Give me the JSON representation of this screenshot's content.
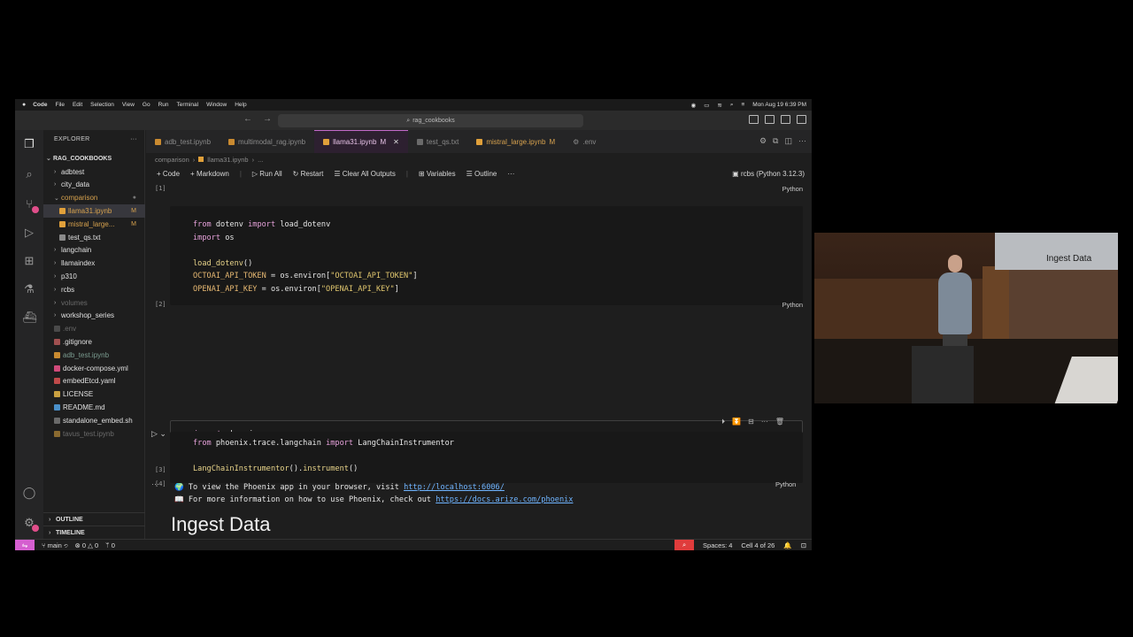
{
  "menubar": {
    "app": "Code",
    "items": [
      "File",
      "Edit",
      "Selection",
      "View",
      "Go",
      "Run",
      "Terminal",
      "Window",
      "Help"
    ],
    "datetime": "Mon Aug 19 6:39 PM"
  },
  "titlebar": {
    "search": "rag_cookbooks"
  },
  "sidebar": {
    "title": "EXPLORER",
    "root": "RAG_COOKBOOKS",
    "items": [
      {
        "label": "adbtest",
        "type": "folder"
      },
      {
        "label": "city_data",
        "type": "folder"
      },
      {
        "label": "comparison",
        "type": "folder-open"
      },
      {
        "label": "llama31.ipynb",
        "type": "file",
        "mod": "M"
      },
      {
        "label": "mistral_large...",
        "type": "file",
        "mod": "M"
      },
      {
        "label": "test_qs.txt",
        "type": "file"
      },
      {
        "label": "langchain",
        "type": "folder"
      },
      {
        "label": "llamaindex",
        "type": "folder"
      },
      {
        "label": "p310",
        "type": "folder"
      },
      {
        "label": "rcbs",
        "type": "folder"
      },
      {
        "label": "volumes",
        "type": "folder"
      },
      {
        "label": "workshop_series",
        "type": "folder"
      },
      {
        "label": ".env",
        "type": "file"
      },
      {
        "label": ".gitignore",
        "type": "file"
      },
      {
        "label": "adb_test.ipynb",
        "type": "file"
      },
      {
        "label": "docker-compose.yml",
        "type": "file"
      },
      {
        "label": "embedEtcd.yaml",
        "type": "file"
      },
      {
        "label": "LICENSE",
        "type": "file"
      },
      {
        "label": "README.md",
        "type": "file"
      },
      {
        "label": "standalone_embed.sh",
        "type": "file"
      },
      {
        "label": "tavus_test.ipynb",
        "type": "file"
      }
    ],
    "outline": "OUTLINE",
    "timeline": "TIMELINE"
  },
  "tabs": [
    {
      "label": "adb_test.ipynb"
    },
    {
      "label": "multimodal_rag.ipynb"
    },
    {
      "label": "llama31.ipynb",
      "mod": "M"
    },
    {
      "label": "test_qs.txt"
    },
    {
      "label": "mistral_large.ipynb",
      "mod": "M"
    },
    {
      "label": ".env"
    }
  ],
  "breadcrumb": [
    "comparison",
    "llama31.ipynb",
    "..."
  ],
  "toolbar": {
    "code": "Code",
    "markdown": "Markdown",
    "run_all": "Run All",
    "restart": "Restart",
    "clear": "Clear All Outputs",
    "variables": "Variables",
    "outline": "Outline",
    "kernel": "rcbs (Python 3.12.3)"
  },
  "cells": {
    "c1_no": "[1]",
    "c2_no": "[2]",
    "c3_no": "[3]",
    "c4_no": "[4]",
    "lang": "Python",
    "out1_text": "To view the Phoenix app in your browser, visit ",
    "out1_link": "http://localhost:6006/",
    "out2_text": "For more information on how to use Phoenix, check out ",
    "out2_link": "https://docs.arize.com/phoenix",
    "heading": "Ingest Data"
  },
  "statusbar": {
    "branch": "main",
    "errors": "0",
    "warnings": "0",
    "ports": "0",
    "spaces": "Spaces: 4",
    "cell": "Cell 4 of 26"
  },
  "video": {
    "slide_title": "Ingest Data"
  }
}
